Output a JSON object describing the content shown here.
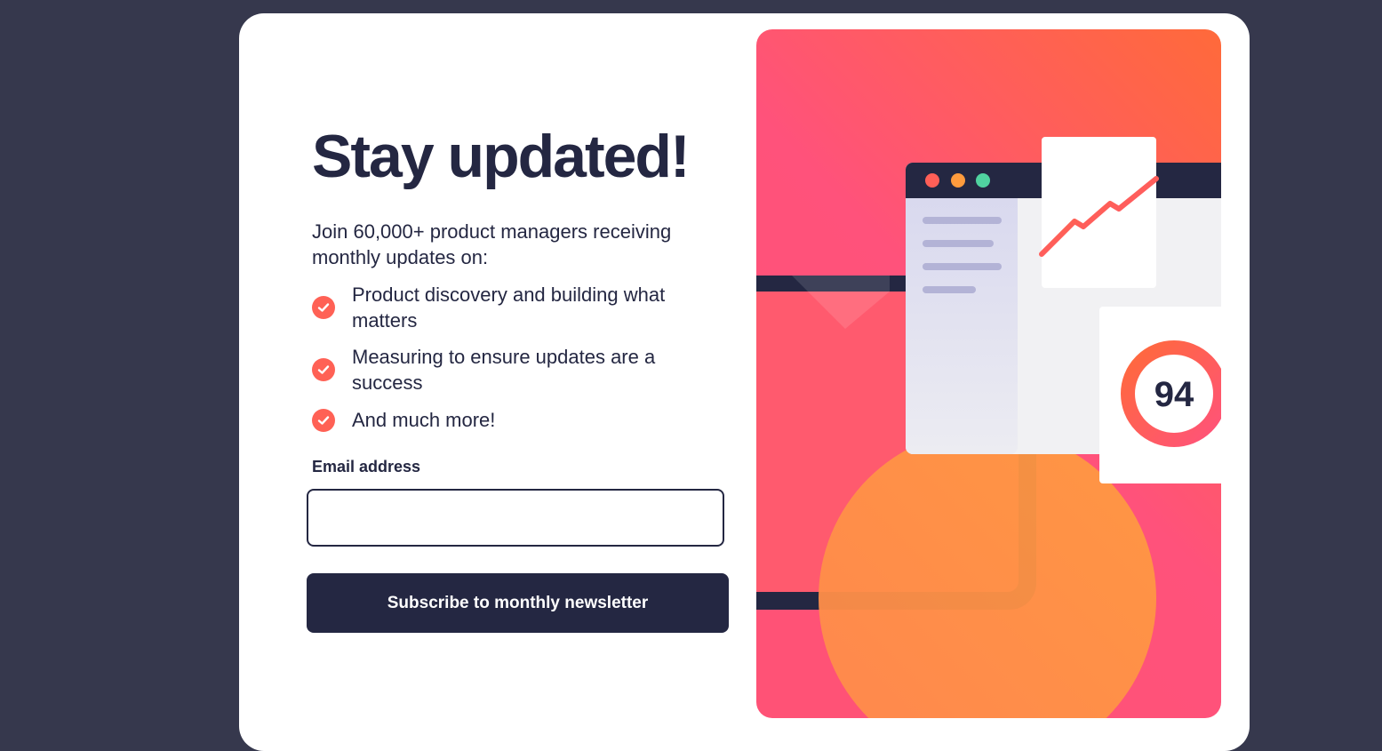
{
  "signup": {
    "title": "Stay updated!",
    "intro": "Join 60,000+ product managers receiving monthly updates on:",
    "features": [
      "Product discovery and building what matters",
      "Measuring to ensure updates are a success",
      "And much more!"
    ],
    "email_label": "Email address",
    "email_value": "",
    "subscribe_label": "Subscribe to monthly newsletter"
  },
  "illustration": {
    "score": "94"
  },
  "colors": {
    "background": "#36384d",
    "dark_navy": "#242742",
    "tomato": "#ff6155",
    "white": "#ffffff"
  }
}
